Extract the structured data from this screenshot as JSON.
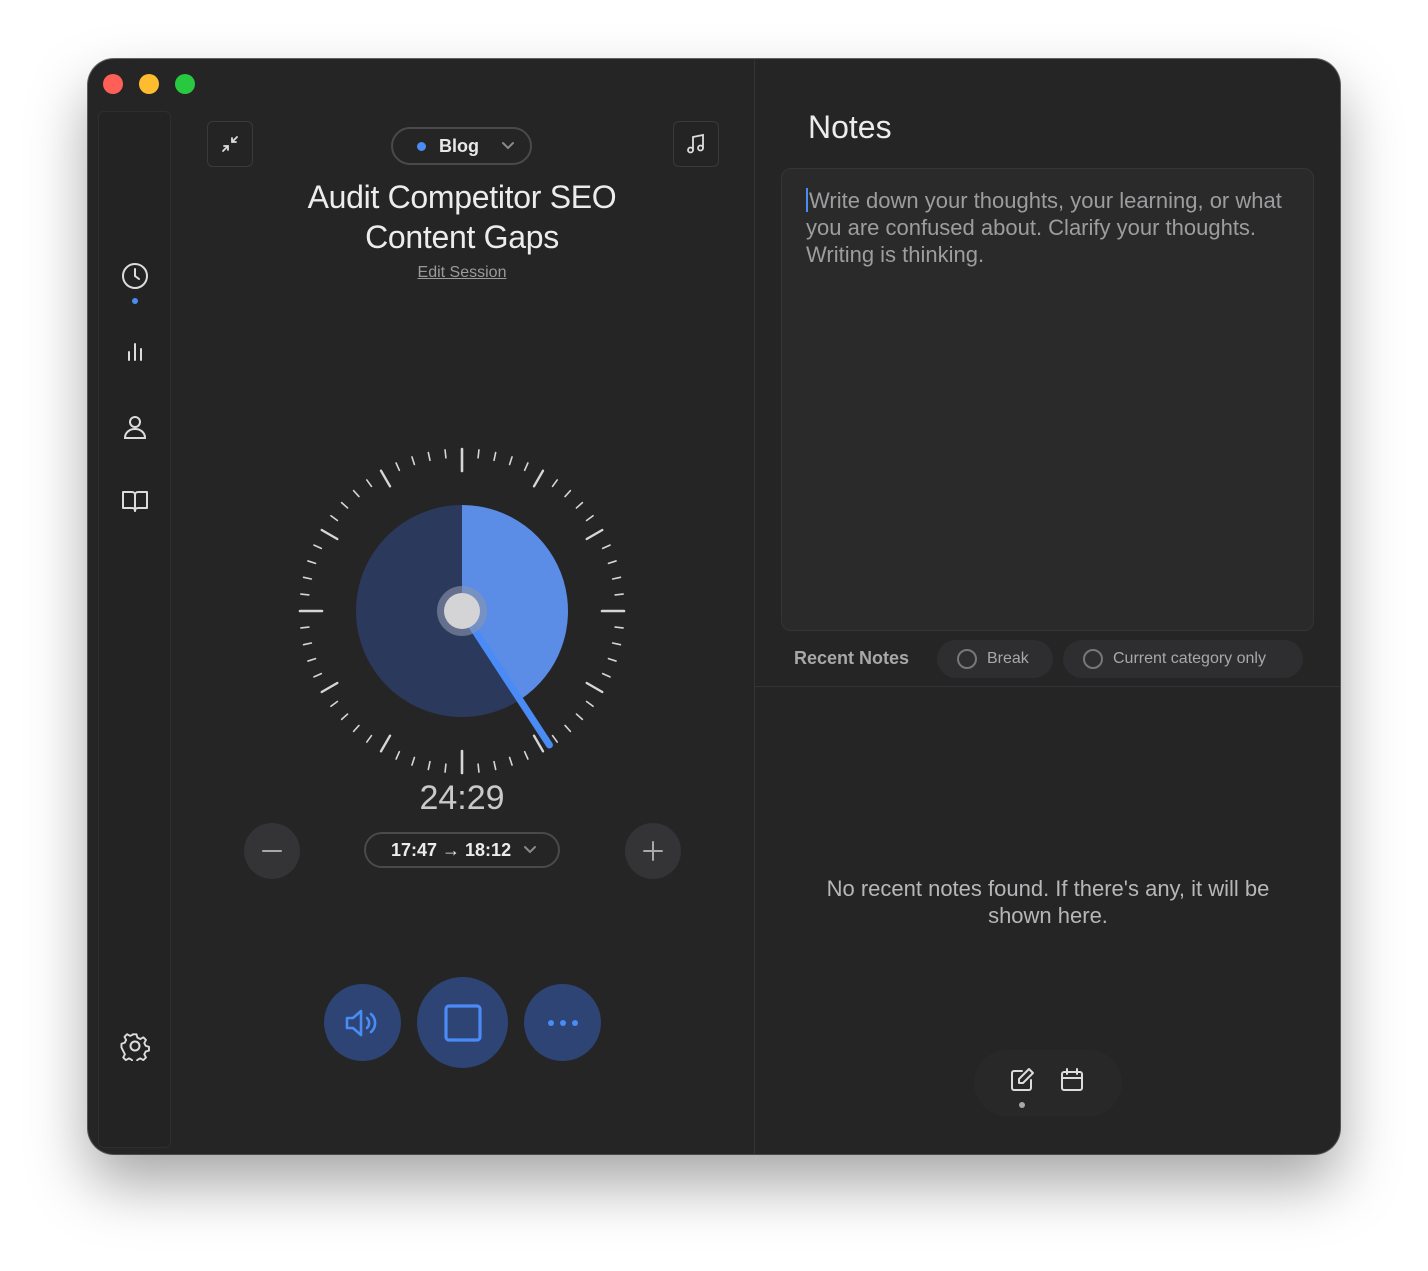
{
  "window": {
    "close_color": "#fe5f57",
    "minimize_color": "#febc2e",
    "zoom_color": "#28c840"
  },
  "sidebar": {
    "items": [
      {
        "icon": "clock-icon",
        "active": true
      },
      {
        "icon": "bar-chart-icon",
        "active": false
      },
      {
        "icon": "person-icon",
        "active": false
      },
      {
        "icon": "book-icon",
        "active": false
      }
    ],
    "settings_icon": "gear-icon"
  },
  "session": {
    "category": "Blog",
    "category_color": "#4a8bf5",
    "title": "Audit Competitor SEO Content Gaps",
    "edit_label": "Edit Session"
  },
  "timer": {
    "remaining": "24:29",
    "time_range": "17:47 → 18:12",
    "progress_fraction": 0.408,
    "accent_color": "#4a8bf5"
  },
  "controls": {
    "sound_icon": "speaker-icon",
    "stop_icon": "stop-icon",
    "more_icon": "ellipsis-icon"
  },
  "notes": {
    "heading": "Notes",
    "placeholder": "Write down your thoughts, your learning, or what you are confused about. Clarify your thoughts. Writing is thinking."
  },
  "recent": {
    "label": "Recent Notes",
    "filters": [
      "Break",
      "Current category only"
    ],
    "empty_message": "No recent notes found. If there's any, it will be shown here."
  },
  "bottom_tabs": [
    {
      "icon": "compose-icon",
      "active": true
    },
    {
      "icon": "calendar-icon",
      "active": false
    }
  ]
}
